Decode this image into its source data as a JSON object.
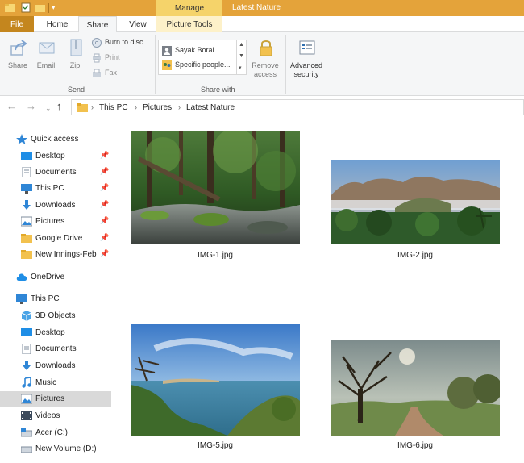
{
  "window": {
    "title": "Latest Nature",
    "contextual_tab": "Manage"
  },
  "tabs": [
    "File",
    "Home",
    "Share",
    "View",
    "Picture Tools"
  ],
  "ribbon": {
    "send": {
      "label": "Send",
      "share": "Share",
      "email": "Email",
      "zip": "Zip",
      "burn": "Burn to disc",
      "print": "Print",
      "fax": "Fax"
    },
    "share_with": {
      "label": "Share with",
      "items": [
        "Sayak Boral",
        "Specific people..."
      ],
      "remove_access": [
        "Remove",
        "access"
      ],
      "advanced_security": [
        "Advanced",
        "security"
      ]
    }
  },
  "address": {
    "crumbs": [
      "This PC",
      "Pictures",
      "Latest Nature"
    ]
  },
  "sidebar": {
    "quick_access": "Quick access",
    "pinned": [
      "Desktop",
      "Documents",
      "This PC",
      "Downloads",
      "Pictures",
      "Google Drive",
      "New Innings-Feb"
    ],
    "onedrive": "OneDrive",
    "this_pc": "This PC",
    "this_pc_items": [
      "3D Objects",
      "Desktop",
      "Documents",
      "Downloads",
      "Music",
      "Pictures",
      "Videos",
      "Acer (C:)",
      "New Volume (D:)"
    ],
    "selected": "Pictures"
  },
  "files": [
    "IMG-1.jpg",
    "IMG-2.jpg",
    "IMG-5.jpg",
    "IMG-6.jpg"
  ],
  "colors": {
    "titlebar": "#e4a33a",
    "file_tab": "#c4861e",
    "manage_tab": "#f5d36a",
    "selection": "#d9d9d9"
  }
}
